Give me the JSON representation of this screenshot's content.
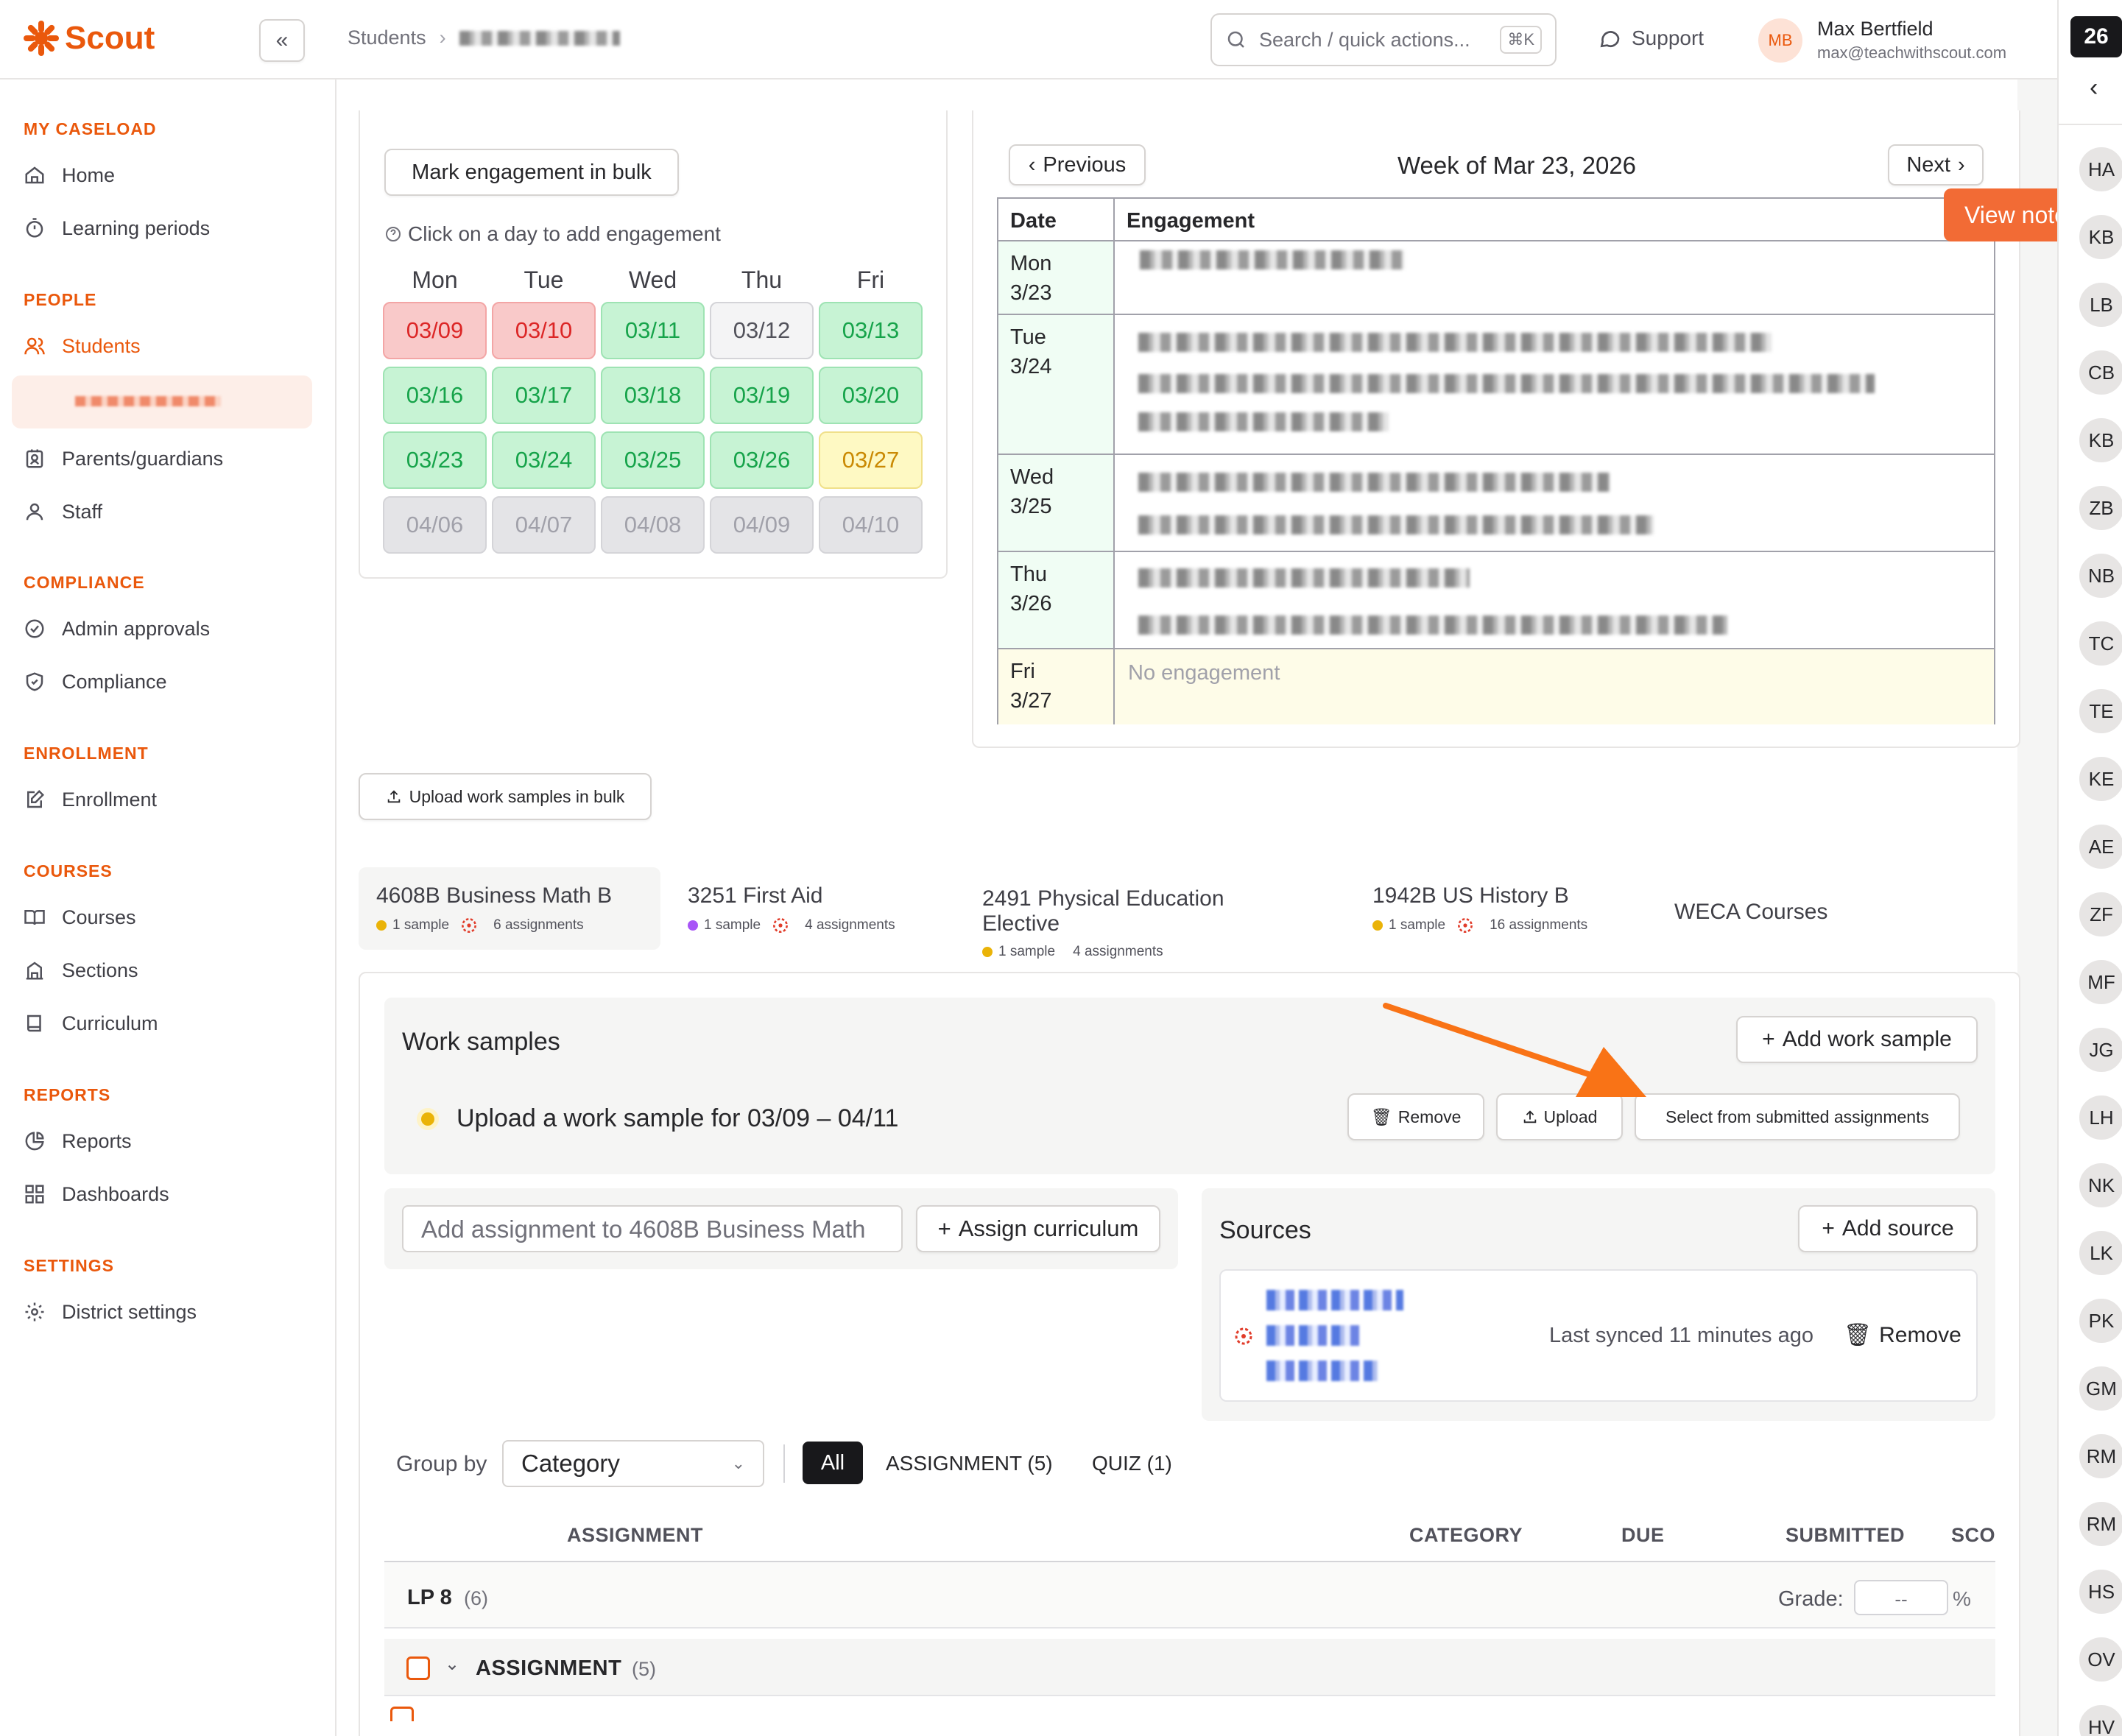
{
  "app": {
    "name": "Scout"
  },
  "header": {
    "breadcrumb_root": "Students",
    "search_placeholder": "Search / quick actions...",
    "search_shortcut": "⌘K",
    "support": "Support",
    "user_initials": "MB",
    "user_name": "Max Bertfield",
    "user_email": "max@teachwithscout.com"
  },
  "sidebar": {
    "sections": [
      {
        "title": "MY CASELOAD",
        "items": [
          "Home",
          "Learning periods"
        ]
      },
      {
        "title": "PEOPLE",
        "items": [
          "Students",
          "Parents/guardians",
          "Staff"
        ]
      },
      {
        "title": "COMPLIANCE",
        "items": [
          "Admin approvals",
          "Compliance"
        ]
      },
      {
        "title": "ENROLLMENT",
        "items": [
          "Enrollment"
        ]
      },
      {
        "title": "COURSES",
        "items": [
          "Courses",
          "Sections",
          "Curriculum"
        ]
      },
      {
        "title": "REPORTS",
        "items": [
          "Reports",
          "Dashboards"
        ]
      },
      {
        "title": "SETTINGS",
        "items": [
          "District settings"
        ]
      }
    ]
  },
  "engagement": {
    "bulk_button": "Mark engagement in bulk",
    "hint": "Click on a day to add engagement",
    "weekdays": [
      "Mon",
      "Tue",
      "Wed",
      "Thu",
      "Fri"
    ],
    "weeks": [
      [
        {
          "d": "03/09",
          "s": "red"
        },
        {
          "d": "03/10",
          "s": "red"
        },
        {
          "d": "03/11",
          "s": "green"
        },
        {
          "d": "03/12",
          "s": "gray"
        },
        {
          "d": "03/13",
          "s": "green"
        }
      ],
      [
        {
          "d": "03/16",
          "s": "green"
        },
        {
          "d": "03/17",
          "s": "green"
        },
        {
          "d": "03/18",
          "s": "green"
        },
        {
          "d": "03/19",
          "s": "green"
        },
        {
          "d": "03/20",
          "s": "green"
        }
      ],
      [
        {
          "d": "03/23",
          "s": "green"
        },
        {
          "d": "03/24",
          "s": "green"
        },
        {
          "d": "03/25",
          "s": "green"
        },
        {
          "d": "03/26",
          "s": "green"
        },
        {
          "d": "03/27",
          "s": "yellow"
        }
      ],
      [
        {
          "d": "04/06",
          "s": "future"
        },
        {
          "d": "04/07",
          "s": "future"
        },
        {
          "d": "04/08",
          "s": "future"
        },
        {
          "d": "04/09",
          "s": "future"
        },
        {
          "d": "04/10",
          "s": "future"
        }
      ]
    ]
  },
  "week": {
    "prev": "Previous",
    "next": "Next",
    "title": "Week of Mar 23, 2026",
    "col_date": "Date",
    "col_engagement": "Engagement",
    "rows": [
      {
        "day": "Mon",
        "date": "3/23"
      },
      {
        "day": "Tue",
        "date": "3/24"
      },
      {
        "day": "Wed",
        "date": "3/25"
      },
      {
        "day": "Thu",
        "date": "3/26"
      },
      {
        "day": "Fri",
        "date": "3/27",
        "text": "No engagement"
      }
    ]
  },
  "view_notes": "View notes",
  "upload_bulk": "Upload work samples in bulk",
  "course_tabs": [
    {
      "name": "4608B Business Math B",
      "samples": "1 sample",
      "assignments": "6 assignments",
      "color": "#eab308",
      "canvas": true
    },
    {
      "name": "3251 First Aid",
      "samples": "1 sample",
      "assignments": "4 assignments",
      "color": "#a855f7",
      "canvas": true
    },
    {
      "name": "2491 Physical Education Elective",
      "samples": "1 sample",
      "assignments": "4 assignments",
      "color": "#eab308",
      "canvas": false
    },
    {
      "name": "1942B US History B",
      "samples": "1 sample",
      "assignments": "16 assignments",
      "color": "#eab308",
      "canvas": true
    },
    {
      "name": "WECA Courses",
      "samples": "",
      "assignments": "",
      "color": "",
      "canvas": false
    }
  ],
  "work_samples": {
    "title": "Work samples",
    "add": "Add work sample",
    "prompt": "Upload a work sample for 03/09 – 04/11",
    "remove": "Remove",
    "upload": "Upload",
    "select": "Select from submitted assignments"
  },
  "assign": {
    "placeholder": "Add assignment to 4608B Business Math",
    "curriculum": "Assign curriculum"
  },
  "sources": {
    "title": "Sources",
    "add": "Add source",
    "synced": "Last synced 11 minutes ago",
    "remove": "Remove"
  },
  "filters": {
    "group_by": "Group by",
    "group_value": "Category",
    "all": "All",
    "assignment": "ASSIGNMENT (5)",
    "quiz": "QUIZ (1)"
  },
  "table": {
    "cols": [
      "ASSIGNMENT",
      "CATEGORY",
      "DUE",
      "SUBMITTED",
      "SCO"
    ],
    "group": "LP 8",
    "group_count": "(6)",
    "grade_label": "Grade:",
    "grade_value": "--",
    "grade_unit": "%",
    "sub": "ASSIGNMENT",
    "sub_count": "(5)"
  },
  "right_panel": {
    "badge": "26",
    "initials": [
      "HA",
      "KB",
      "LB",
      "CB",
      "KB",
      "ZB",
      "NB",
      "TC",
      "TE",
      "KE",
      "AE",
      "ZF",
      "MF",
      "JG",
      "LH",
      "NK",
      "LK",
      "PK",
      "GM",
      "RM",
      "RM",
      "HS",
      "OV",
      "HV"
    ]
  },
  "colors": {
    "accent": "#ea580c",
    "arrow": "#f97316"
  }
}
